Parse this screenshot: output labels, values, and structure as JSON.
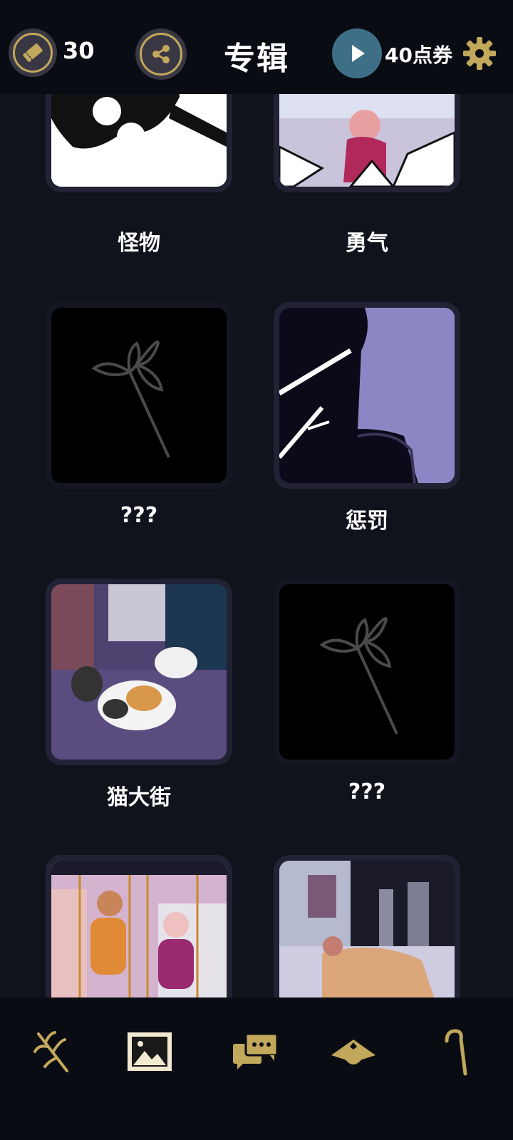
{
  "header": {
    "ticket_count": "30",
    "title": "专辑",
    "coupon_text": "40点券"
  },
  "albums": [
    {
      "label": "怪物",
      "locked": false
    },
    {
      "label": "勇气",
      "locked": false
    },
    {
      "label": "???",
      "locked": true
    },
    {
      "label": "惩罚",
      "locked": false
    },
    {
      "label": "猫大街",
      "locked": false
    },
    {
      "label": "???",
      "locked": true
    },
    {
      "label": "",
      "locked": false
    },
    {
      "label": "",
      "locked": false
    }
  ],
  "icons": {
    "ticket": "ticket-icon",
    "share": "share-icon",
    "play": "play-icon",
    "gear": "gear-icon",
    "nav": [
      "flower-branch-icon",
      "gallery-icon",
      "chat-icon",
      "rice-hat-icon",
      "cane-icon"
    ]
  },
  "colors": {
    "accent_gold": "#c2a85b",
    "play_teal": "#3e6f86",
    "background": "#10131c",
    "bar": "#0a0c14"
  }
}
